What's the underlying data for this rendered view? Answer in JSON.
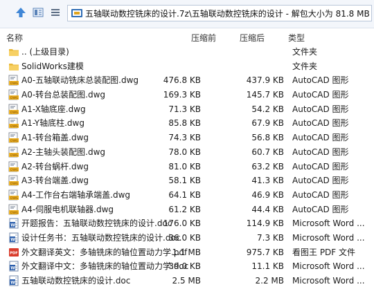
{
  "path": {
    "text": "五轴联动数控铣床的设计.7z\\五轴联动数控铣床的设计 - 解包大小为 81.8 MB"
  },
  "columns": {
    "name": "名称",
    "packed": "压缩前",
    "unpacked": "压缩后",
    "type": "类型"
  },
  "rows": [
    {
      "name": ".. (上级目录)",
      "size1": "",
      "size2": "",
      "type": "文件夹",
      "icon": "folder-icon"
    },
    {
      "name": "SolidWorks建模",
      "size1": "",
      "size2": "",
      "type": "文件夹",
      "icon": "folder-icon"
    },
    {
      "name": "A0-五轴联动铣床总装配图.dwg",
      "size1": "476.8 KB",
      "size2": "437.9 KB",
      "type": "AutoCAD 图形",
      "icon": "dwg-icon"
    },
    {
      "name": "A0-转台总装配图.dwg",
      "size1": "169.3 KB",
      "size2": "145.7 KB",
      "type": "AutoCAD 图形",
      "icon": "dwg-icon"
    },
    {
      "name": "A1-X轴底座.dwg",
      "size1": "71.3 KB",
      "size2": "54.2 KB",
      "type": "AutoCAD 图形",
      "icon": "dwg-icon"
    },
    {
      "name": "A1-Y轴底柱.dwg",
      "size1": "85.8 KB",
      "size2": "67.9 KB",
      "type": "AutoCAD 图形",
      "icon": "dwg-icon"
    },
    {
      "name": "A1-转台箱盖.dwg",
      "size1": "74.3 KB",
      "size2": "56.8 KB",
      "type": "AutoCAD 图形",
      "icon": "dwg-icon"
    },
    {
      "name": "A2-主轴头装配图.dwg",
      "size1": "78.0 KB",
      "size2": "60.7 KB",
      "type": "AutoCAD 图形",
      "icon": "dwg-icon"
    },
    {
      "name": "A2-转台蜗杆.dwg",
      "size1": "81.0 KB",
      "size2": "63.2 KB",
      "type": "AutoCAD 图形",
      "icon": "dwg-icon"
    },
    {
      "name": "A3-转台端盖.dwg",
      "size1": "58.1 KB",
      "size2": "41.3 KB",
      "type": "AutoCAD 图形",
      "icon": "dwg-icon"
    },
    {
      "name": "A4-工作台右端轴承端盖.dwg",
      "size1": "64.1 KB",
      "size2": "46.9 KB",
      "type": "AutoCAD 图形",
      "icon": "dwg-icon"
    },
    {
      "name": "A4-伺服电机联轴器.dwg",
      "size1": "61.2 KB",
      "size2": "44.4 KB",
      "type": "AutoCAD 图形",
      "icon": "dwg-icon"
    },
    {
      "name": "开题报告：五轴联动数控铣床的设计.doc",
      "size1": "176.0 KB",
      "size2": "114.9 KB",
      "type": "Microsoft Word ...",
      "icon": "word-doc-icon"
    },
    {
      "name": "设计任务书：五轴联动数控铣床的设计.doc",
      "size1": "36.0 KB",
      "size2": "7.3 KB",
      "type": "Microsoft Word ...",
      "icon": "word-doc-icon"
    },
    {
      "name": "外文翻译英文：多轴铣床的轴位置动力学.pdf",
      "size1": "1.1 MB",
      "size2": "975.7 KB",
      "type": "看图王 PDF 文件",
      "icon": "pdf-icon"
    },
    {
      "name": "外文翻译中文：多轴铣床的轴位置动力学.doc",
      "size1": "39.0 KB",
      "size2": "11.1 KB",
      "type": "Microsoft Word ...",
      "icon": "word-doc-icon"
    },
    {
      "name": "五轴联动数控铣床的设计.doc",
      "size1": "2.5 MB",
      "size2": "2.2 MB",
      "type": "Microsoft Word ...",
      "icon": "word-doc-icon"
    }
  ]
}
